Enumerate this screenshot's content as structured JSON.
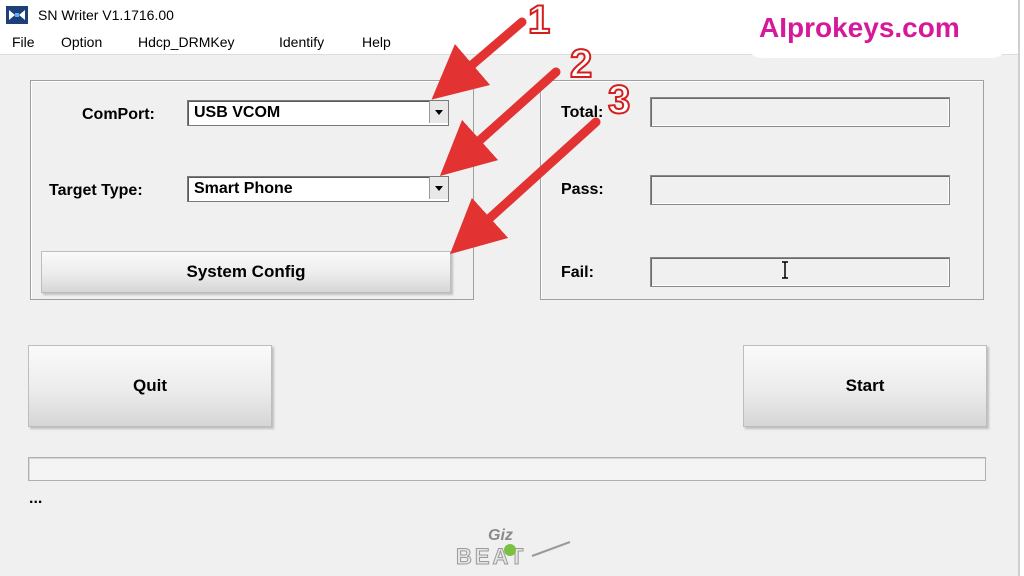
{
  "window": {
    "title": "SN Writer V1.1716.00",
    "menu": [
      "File",
      "Option",
      "Hdcp_DRMKey",
      "Identify",
      "Help"
    ]
  },
  "watermark": "AIprokeys.com",
  "settings": {
    "comport_label": "ComPort:",
    "comport_value": "USB VCOM",
    "target_label": "Target Type:",
    "target_value": "Smart Phone",
    "system_config_label": "System Config"
  },
  "counters": {
    "total_label": "Total:",
    "pass_label": "Pass:",
    "fail_label": "Fail:"
  },
  "actions": {
    "quit_label": "Quit",
    "start_label": "Start"
  },
  "status_text": "...",
  "annotations": [
    "1",
    "2",
    "3"
  ],
  "logo": {
    "line1": "Giz",
    "line2": "BEAT"
  },
  "colors": {
    "arrow": "#e23232",
    "watermark": "#d6189a"
  }
}
